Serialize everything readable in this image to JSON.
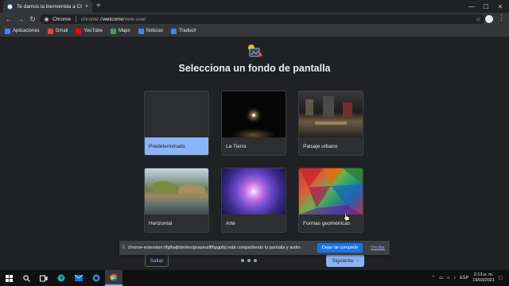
{
  "browser": {
    "tab_title": "Te damos la bienvenida a Chrome",
    "tab_close": "×",
    "new_tab": "+",
    "chip_label": "Chrome",
    "url_scheme": "chrome://",
    "url_host": "welcome",
    "url_path": "/new-user",
    "star": "☆",
    "menu": "⋮"
  },
  "bookmarks": [
    {
      "label": "Aplicaciones",
      "color": "#4285f4"
    },
    {
      "label": "Gmail",
      "color": "#ea4335"
    },
    {
      "label": "YouTube",
      "color": "#ff0000"
    },
    {
      "label": "Maps",
      "color": "#34a853"
    },
    {
      "label": "Noticias",
      "color": "#4285f4"
    },
    {
      "label": "Traducir",
      "color": "#4285f4"
    }
  ],
  "page": {
    "heading": "Selecciona un fondo de pantalla",
    "wallpapers": [
      {
        "label": "Predeterminado",
        "selected": true
      },
      {
        "label": "La Tierra",
        "selected": false
      },
      {
        "label": "Paisaje urbano",
        "selected": false
      },
      {
        "label": "Horizontal",
        "selected": false
      },
      {
        "label": "Arte",
        "selected": false
      },
      {
        "label": "Formas geométricas",
        "selected": false
      }
    ],
    "skip_label": "Saltar",
    "next_label": "Siguiente",
    "next_arrow": "›"
  },
  "sharebar": {
    "grip": "⦀",
    "message": "chrome-extension://fglhaljbbnlmoipoaamafffhpgplbj está compartiendo tu pantalla y audio.",
    "stop_label": "Dejar de compartir",
    "hide_label": "Ocultar"
  },
  "taskbar": {
    "lang": "ESP",
    "time": "2:13 p. m.",
    "date": "19/03/2021"
  },
  "colors": {
    "accent": "#8ab4f8",
    "share_button": "#1a73e8"
  }
}
